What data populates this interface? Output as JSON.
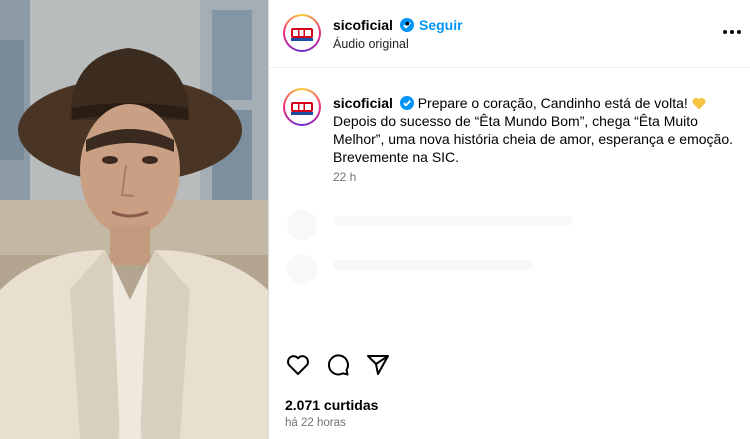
{
  "post": {
    "username": "sicoficial",
    "follow_label": "Seguir",
    "separator": "•",
    "audio_label": "Áudio original"
  },
  "caption": {
    "username": "sicoficial",
    "text_line1": "Prepare o coração, Candinho está de volta!",
    "text_line2": "Depois do sucesso de “Êta Mundo Bom”, chega “Êta Muito Melhor”, uma nova história cheia de amor, esperança e emoção. Brevemente na SIC.",
    "time": "22 h",
    "emoji": "yellow-heart"
  },
  "stats": {
    "likes": "2.071 curtidas",
    "posted_ago": "há 22 horas"
  },
  "icons": {
    "like": "heart-icon",
    "comment": "comment-icon",
    "share": "share-icon",
    "more": "more-options-icon",
    "verified": "verified-badge-icon"
  },
  "colors": {
    "accent": "#0095f6",
    "verified": "#0095f6",
    "muted": "#737373",
    "sic_red": "#d7001b",
    "sic_blue": "#1b4fa1"
  }
}
